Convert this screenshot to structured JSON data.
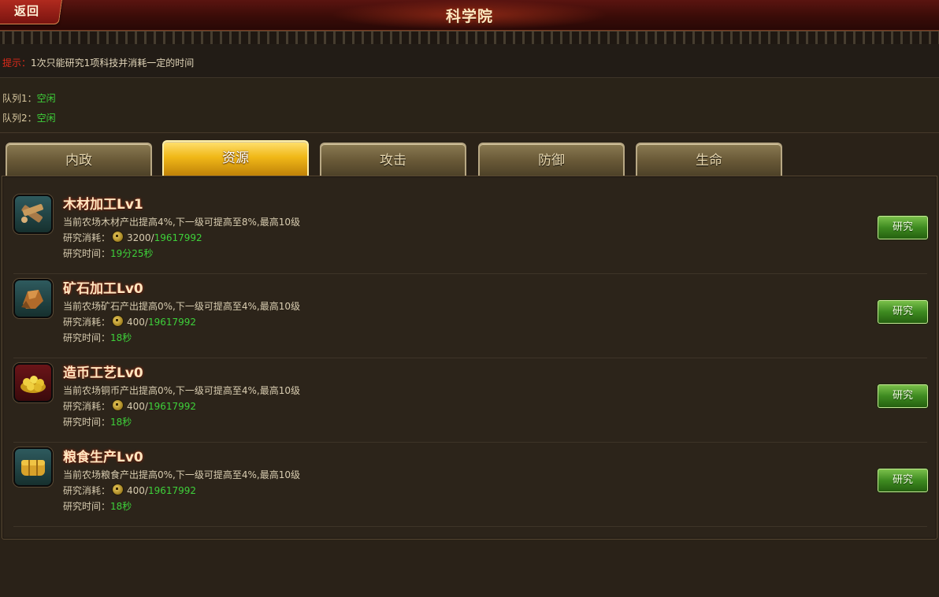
{
  "header": {
    "back_label": "返回",
    "title": "科学院"
  },
  "tip": {
    "label": "提示：",
    "text": "1次只能研究1项科技并消耗一定的时间"
  },
  "queues": [
    {
      "label": "队列1：",
      "status": "空闲"
    },
    {
      "label": "队列2：",
      "status": "空闲"
    }
  ],
  "tabs": [
    {
      "label": "内政"
    },
    {
      "label": "资源",
      "active": true
    },
    {
      "label": "攻击"
    },
    {
      "label": "防御"
    },
    {
      "label": "生命"
    }
  ],
  "items": [
    {
      "icon": "wood-icon",
      "name": "木材加工Lv1",
      "desc": "当前农场木材产出提高4%,下一级可提高至8%,最高10级",
      "cost_label": "研究消耗：",
      "cost_current": "3200",
      "cost_sep": "/",
      "cost_total": "19617992",
      "time_label": "研究时间：",
      "time_value": "19分25秒",
      "button_label": "研究"
    },
    {
      "icon": "ore-icon",
      "name": "矿石加工Lv0",
      "desc": "当前农场矿石产出提高0%,下一级可提高至4%,最高10级",
      "cost_label": "研究消耗：",
      "cost_current": "400",
      "cost_sep": "/",
      "cost_total": "19617992",
      "time_label": "研究时间：",
      "time_value": "18秒",
      "button_label": "研究"
    },
    {
      "icon": "coins-icon",
      "name": "造币工艺Lv0",
      "desc": "当前农场铜币产出提高0%,下一级可提高至4%,最高10级",
      "cost_label": "研究消耗：",
      "cost_current": "400",
      "cost_sep": "/",
      "cost_total": "19617992",
      "time_label": "研究时间：",
      "time_value": "18秒",
      "button_label": "研究"
    },
    {
      "icon": "grain-icon",
      "name": "粮食生产Lv0",
      "desc": "当前农场粮食产出提高0%,下一级可提高至4%,最高10级",
      "cost_label": "研究消耗：",
      "cost_current": "400",
      "cost_sep": "/",
      "cost_total": "19617992",
      "time_label": "研究时间：",
      "time_value": "18秒",
      "button_label": "研究"
    }
  ],
  "colors": {
    "accent_green": "#3ed03a",
    "tip_red": "#e02a1a",
    "tab_active": "#f0b818"
  }
}
